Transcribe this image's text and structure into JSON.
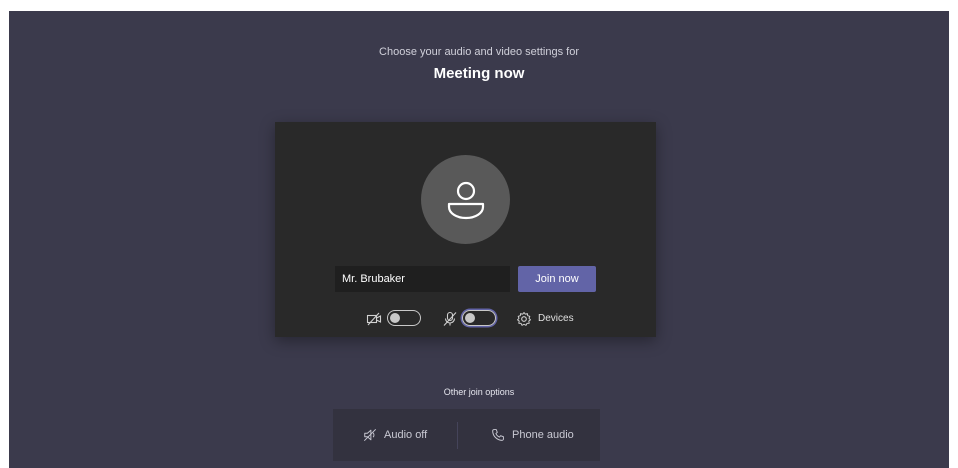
{
  "header": {
    "prompt": "Choose your audio and video settings for",
    "meeting_title": "Meeting now"
  },
  "prejoin": {
    "name_value": "Mr. Brubaker",
    "join_label": "Join now",
    "camera_toggle_on": false,
    "mic_toggle_on": false,
    "devices_label": "Devices"
  },
  "other_options": {
    "label": "Other join options",
    "audio_off_label": "Audio off",
    "phone_audio_label": "Phone audio"
  },
  "colors": {
    "background": "#3b3a4c",
    "card": "#292929",
    "accent": "#6264a7"
  },
  "icons": [
    "avatar-person-icon",
    "camera-off-icon",
    "mic-off-icon",
    "gear-icon",
    "speaker-off-icon",
    "phone-icon"
  ]
}
